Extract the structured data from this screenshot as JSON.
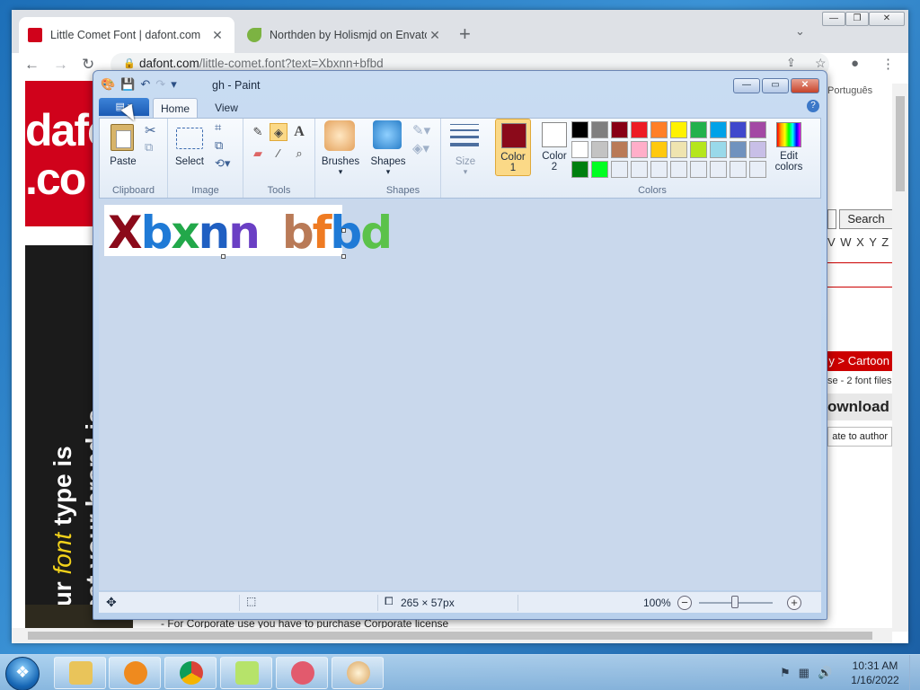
{
  "browser": {
    "tabs": [
      {
        "title": "Little Comet Font | dafont.com",
        "favicon": "dafont-icon"
      },
      {
        "title": "Northden by Holismjd on Envato",
        "favicon": "envato-leaf-icon"
      }
    ],
    "new_tab": "+",
    "url_host": "dafont.com",
    "url_path": "/little-comet.font?text=Xbxnn+bfbd",
    "page": {
      "logo_text": "dafo .co",
      "ad_text_a": "Your ",
      "ad_text_b": "font",
      "ad_text_c": " type is",
      "ad_text_d": "What your brand is",
      "language": "Português",
      "search_button": "Search",
      "alphabet": "V W X Y Z #",
      "category": "y > Cartoon",
      "font_files": "se - 2 font files",
      "download": "ownload",
      "donate": "ate to author",
      "corporate_note": "- For Corporate use you have to purchase Corporate license"
    }
  },
  "paint": {
    "title": "gh - Paint",
    "tabs": {
      "home": "Home",
      "view": "View"
    },
    "groups": {
      "clipboard": {
        "name": "Clipboard",
        "paste": "Paste"
      },
      "image": {
        "name": "Image",
        "select": "Select"
      },
      "tools": {
        "name": "Tools"
      },
      "brushes": {
        "label": "Brushes"
      },
      "shapes": {
        "name": "Shapes",
        "label": "Shapes"
      },
      "size": {
        "label": "Size"
      },
      "colors": {
        "name": "Colors",
        "color1_label": "Color\n1",
        "color1_value": "#8b0a1a",
        "color2_label": "Color\n2",
        "color2_value": "#ffffff",
        "edit": "Edit\ncolors",
        "palette": [
          "#000000",
          "#7f7f7f",
          "#880015",
          "#ed1c24",
          "#ff7f27",
          "#fff200",
          "#22b14c",
          "#00a2e8",
          "#3f48cc",
          "#a349a4",
          "#ffffff",
          "#c3c3c3",
          "#b97a57",
          "#ffaec9",
          "#ffc90e",
          "#efe4b0",
          "#b5e61d",
          "#99d9ea",
          "#7092be",
          "#c8bfe7",
          "#007f0e",
          "#00ff21",
          "#e8eef7",
          "#e8eef7",
          "#e8eef7",
          "#e8eef7",
          "#e8eef7",
          "#e8eef7",
          "#e8eef7",
          "#e8eef7"
        ]
      }
    },
    "canvas_text_left": "Xbxnn",
    "canvas_text_right": "bfbd",
    "status": {
      "size": "265 × 57px",
      "zoom": "100%"
    }
  },
  "taskbar": {
    "time": "10:31 AM",
    "date": "1/16/2022",
    "apps": [
      "explorer-icon",
      "media-player-icon",
      "chrome-icon",
      "sticky-notes-icon",
      "snipping-tool-icon",
      "paint-icon"
    ]
  }
}
